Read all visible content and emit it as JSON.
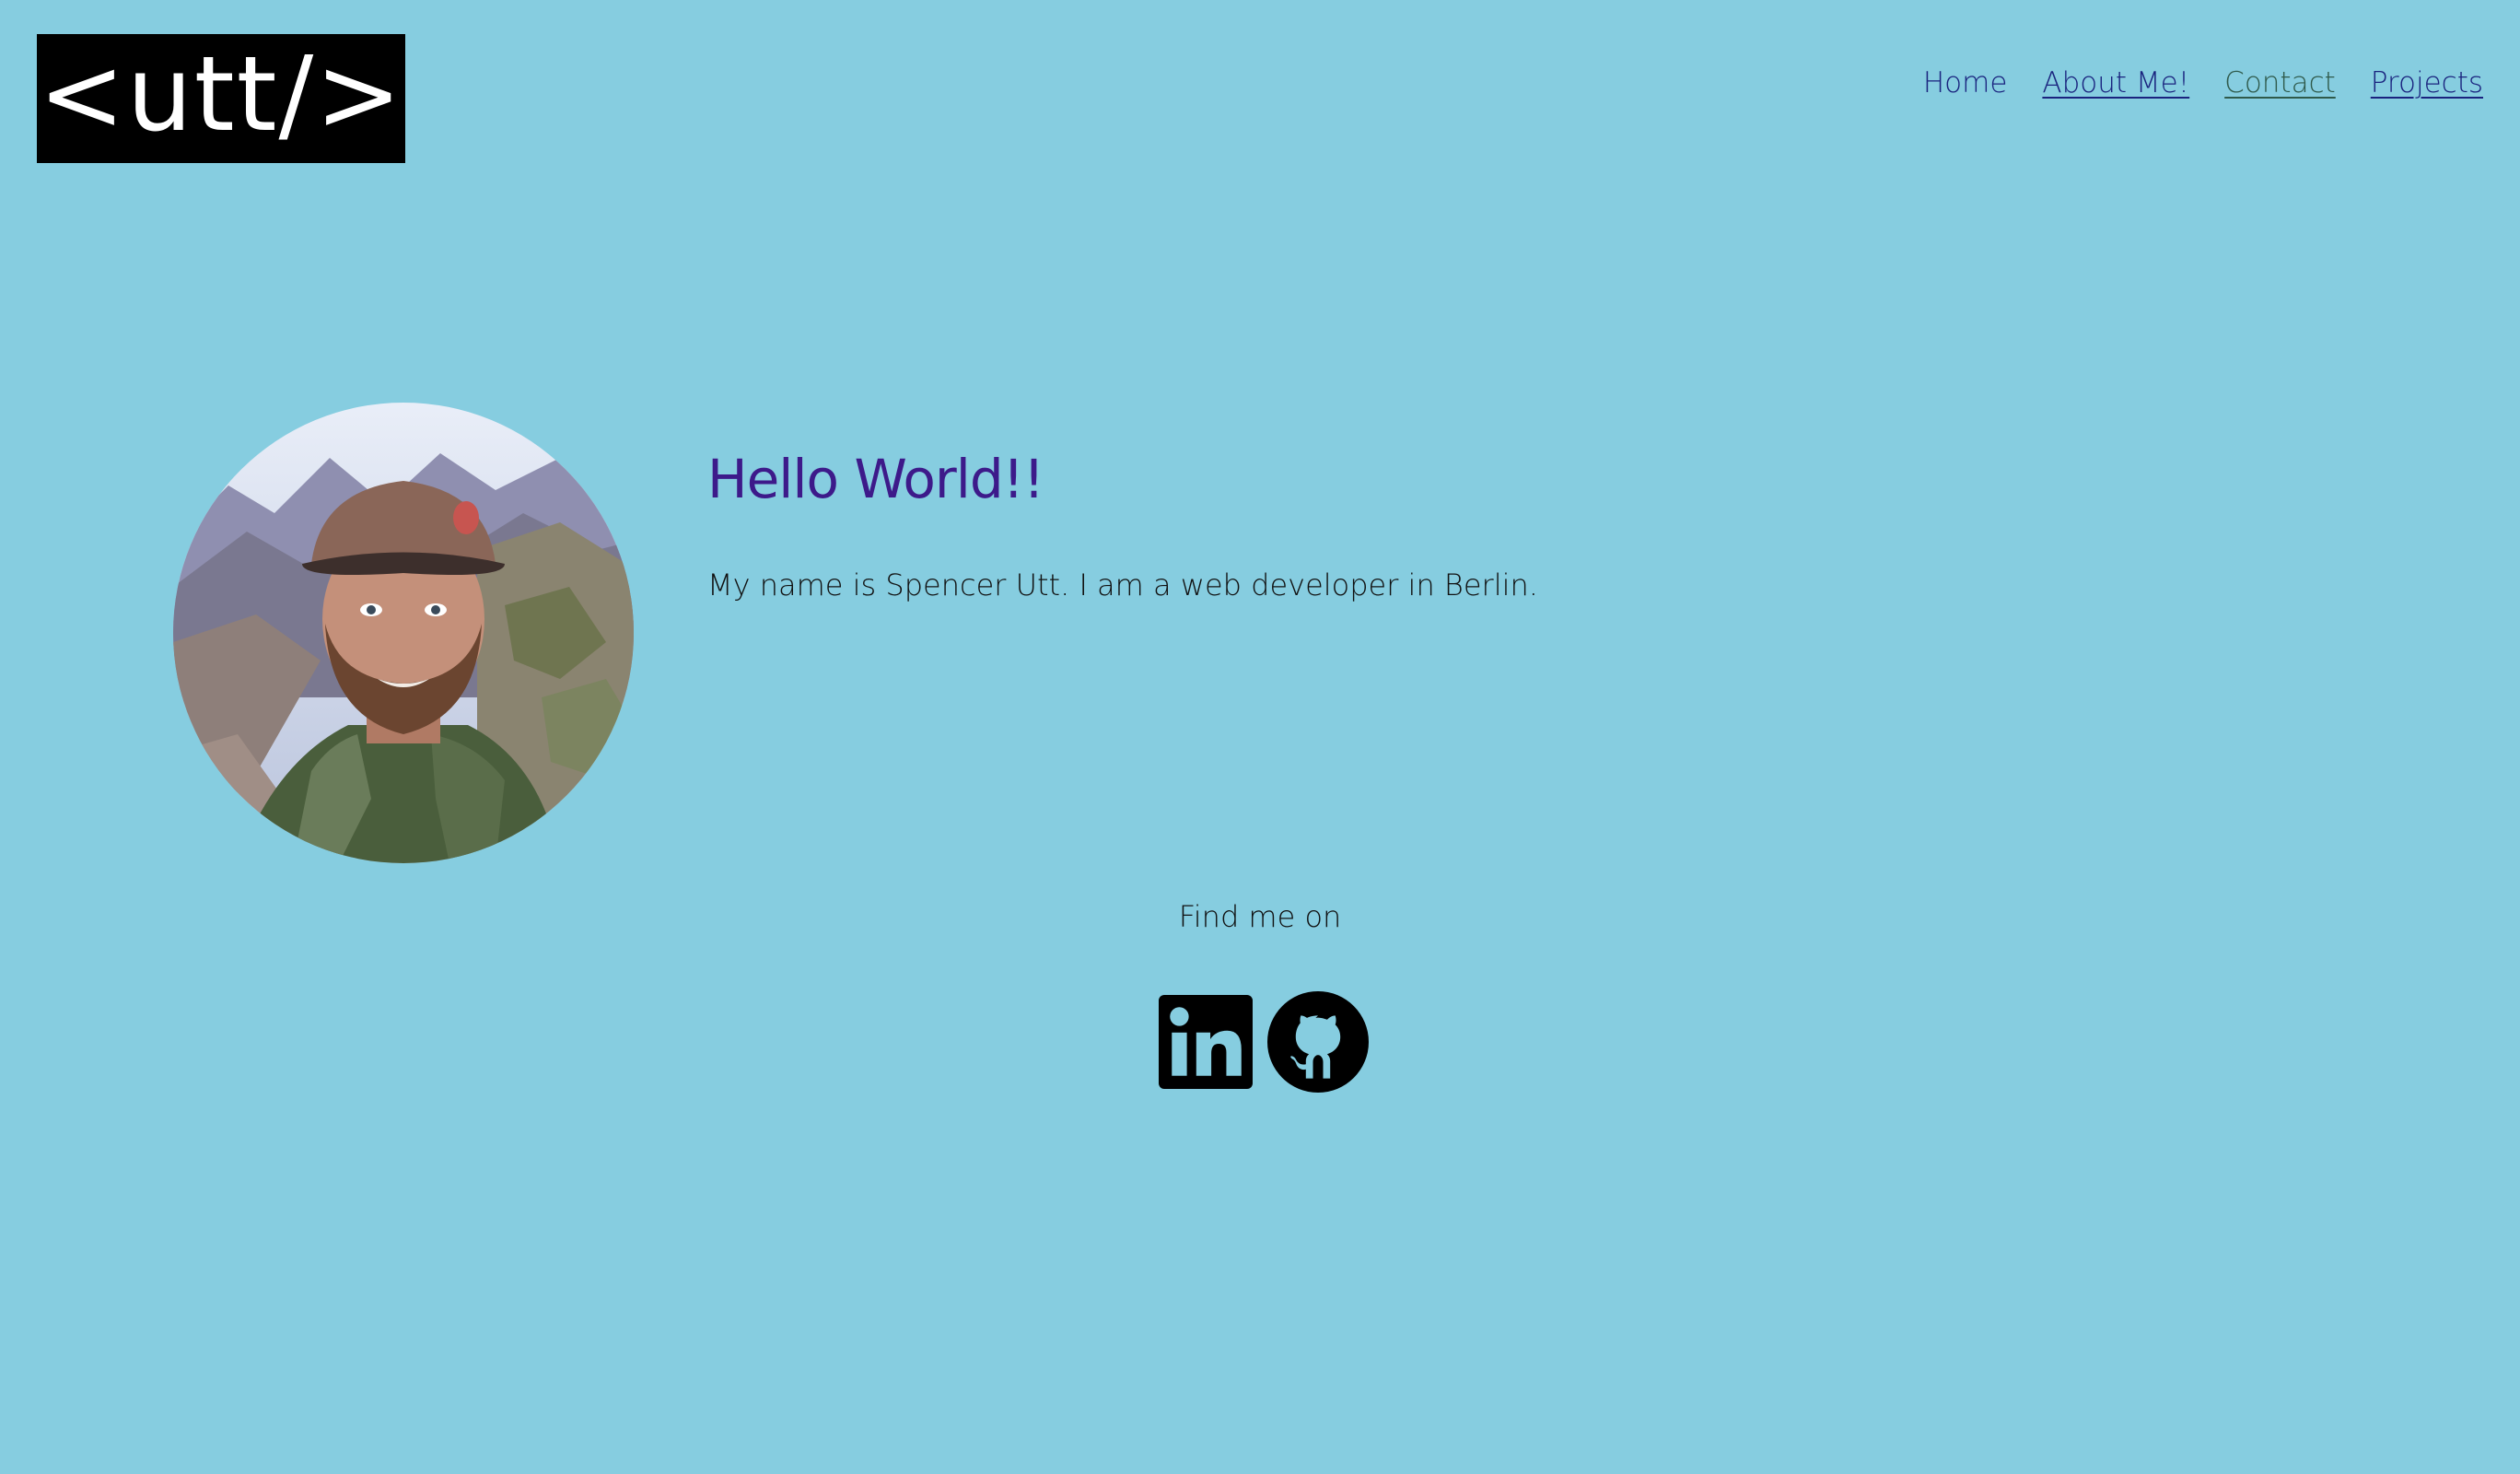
{
  "header": {
    "logo_text": "<utt/>",
    "nav": [
      {
        "label": "Home"
      },
      {
        "label": "About Me!"
      },
      {
        "label": "Contact"
      },
      {
        "label": "Projects"
      }
    ]
  },
  "main": {
    "heading": "Hello World!!",
    "intro": "My name is Spencer Utt. I am a web developer in Berlin.",
    "find_me_label": "Find me on",
    "socials": [
      {
        "icon": "linkedin-icon"
      },
      {
        "icon": "github-icon"
      }
    ]
  },
  "colors": {
    "background": "#86cde0",
    "heading": "#3d1a8a",
    "nav_link": "#1a237e",
    "nav_visited": "#2f5a4b",
    "logo_bg": "#000000",
    "logo_text": "#ffffff"
  }
}
